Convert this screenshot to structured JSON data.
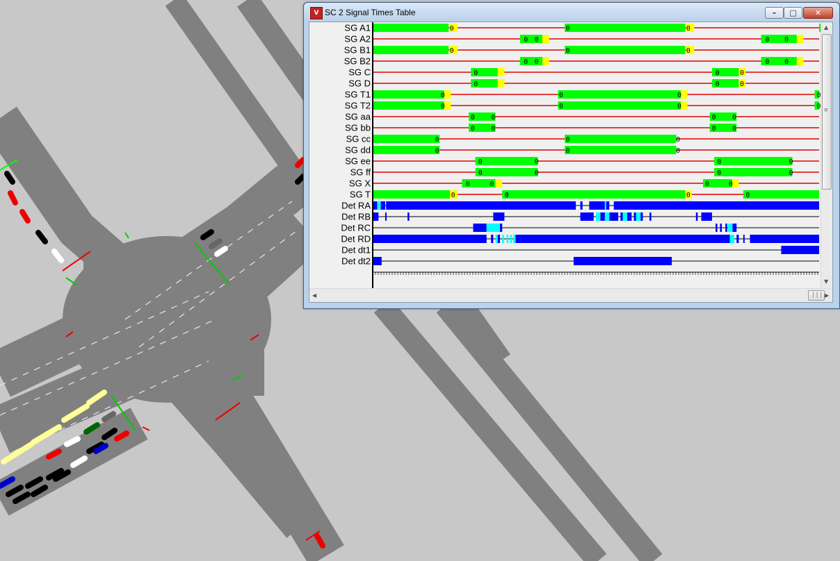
{
  "window": {
    "title": "SC 2 Signal Times Table",
    "app_icon": "vissim-icon",
    "buttons": {
      "minimize": "minimize-icon",
      "maximize": "maximize-icon",
      "close": "close-icon"
    }
  },
  "colors": {
    "green": "#00ff00",
    "amber": "#ffff00",
    "red_line": "#e00000",
    "detector": "#0000ff",
    "detector_occupied": "#00ffff",
    "detector_line": "#000000",
    "background": "#f0f0f0",
    "road": "#808080",
    "ground": "#c8c8c8"
  },
  "signal_table": {
    "time_range": [
      0,
      100
    ],
    "rows": [
      {
        "label": "SG A1",
        "kind": "signal",
        "green": [
          [
            0,
            17
          ],
          [
            43,
            70
          ],
          [
            100,
            100
          ]
        ],
        "green_marks": [
          [
            17,
            17.5
          ],
          [
            70,
            70.5
          ]
        ],
        "amber": [
          [
            17.2,
            19
          ],
          [
            70.2,
            72
          ]
        ],
        "zeros": [
          17,
          43,
          70
        ]
      },
      {
        "label": "SG A2",
        "kind": "signal",
        "green": [
          [
            33,
            38
          ],
          [
            87,
            95
          ]
        ],
        "amber": [
          [
            38,
            39.5
          ],
          [
            95,
            96.5
          ]
        ],
        "zeros": [
          33.6,
          36,
          87.7,
          92
        ]
      },
      {
        "label": "SG B1",
        "kind": "signal",
        "green": [
          [
            0,
            17
          ],
          [
            43,
            70
          ]
        ],
        "amber": [
          [
            17.2,
            19
          ],
          [
            70.2,
            72
          ]
        ],
        "zeros": [
          17,
          43,
          70
        ]
      },
      {
        "label": "SG B2",
        "kind": "signal",
        "green": [
          [
            33,
            38
          ],
          [
            87,
            95
          ]
        ],
        "amber": [
          [
            38,
            39.5
          ],
          [
            95,
            96.5
          ]
        ],
        "zeros": [
          33.6,
          36,
          87.7,
          92
        ]
      },
      {
        "label": "SG C",
        "kind": "signal",
        "green": [
          [
            22,
            28
          ],
          [
            76,
            82
          ]
        ],
        "amber": [
          [
            28,
            29.5
          ],
          [
            82,
            83.5
          ]
        ],
        "zeros": [
          22.4,
          76.5,
          82
        ]
      },
      {
        "label": "SG D",
        "kind": "signal",
        "green": [
          [
            22,
            28
          ],
          [
            76,
            82
          ]
        ],
        "amber": [
          [
            28,
            29.5
          ],
          [
            82,
            83.5
          ]
        ],
        "zeros": [
          22.4,
          76.5,
          82
        ]
      },
      {
        "label": "SG T1",
        "kind": "signal",
        "green": [
          [
            0,
            16
          ],
          [
            41.5,
            69
          ],
          [
            99,
            100
          ]
        ],
        "amber": [
          [
            16,
            17.5
          ],
          [
            69,
            70.5
          ]
        ],
        "zeros": [
          15,
          41.5,
          68,
          99.2
        ]
      },
      {
        "label": "SG T2",
        "kind": "signal",
        "green": [
          [
            0,
            16
          ],
          [
            41.5,
            69
          ],
          [
            99,
            100
          ]
        ],
        "amber": [
          [
            16,
            17.5
          ],
          [
            69,
            70.5
          ]
        ],
        "zeros": [
          15,
          41.5,
          68,
          99.2
        ]
      },
      {
        "label": "SG aa",
        "kind": "signal",
        "green": [
          [
            21.5,
            27.5
          ],
          [
            75.5,
            81.5
          ]
        ],
        "amber": [],
        "zeros": [
          21.7,
          26.3,
          75.7,
          80.3
        ]
      },
      {
        "label": "SG bb",
        "kind": "signal",
        "green": [
          [
            21.5,
            27.5
          ],
          [
            75.5,
            81.5
          ]
        ],
        "amber": [],
        "zeros": [
          21.7,
          26.3,
          75.7,
          80.3
        ]
      },
      {
        "label": "SG cc",
        "kind": "signal",
        "green": [
          [
            0,
            15
          ],
          [
            43,
            68
          ]
        ],
        "amber": [],
        "zeros": [
          13.7,
          43,
          67.7
        ]
      },
      {
        "label": "SG dd",
        "kind": "signal",
        "green": [
          [
            0,
            15
          ],
          [
            43,
            68
          ]
        ],
        "amber": [],
        "zeros": [
          13.7,
          43,
          67.7
        ]
      },
      {
        "label": "SG ee",
        "kind": "signal",
        "green": [
          [
            23,
            37
          ],
          [
            76.5,
            94
          ]
        ],
        "amber": [],
        "zeros": [
          23.4,
          36,
          76.9,
          93
        ]
      },
      {
        "label": "SG ff",
        "kind": "signal",
        "green": [
          [
            23,
            37
          ],
          [
            76.5,
            94
          ]
        ],
        "amber": [],
        "zeros": [
          23.4,
          36,
          76.9,
          93
        ]
      },
      {
        "label": "SG X",
        "kind": "signal",
        "green": [
          [
            20,
            27.5
          ],
          [
            74,
            80.5
          ]
        ],
        "amber": [
          [
            27.5,
            29
          ],
          [
            80.5,
            82
          ]
        ],
        "zeros": [
          20.6,
          26,
          74.2,
          79.5
        ]
      },
      {
        "label": "SG T",
        "kind": "signal",
        "green": [
          [
            0,
            17.3
          ],
          [
            29,
            70
          ],
          [
            83,
            100
          ]
        ],
        "amber": [
          [
            17.3,
            19
          ],
          [
            70,
            71.5
          ]
        ],
        "zeros": [
          17.3,
          29.3,
          70,
          83.3
        ]
      },
      {
        "label": "Det RA",
        "kind": "detector",
        "on": [
          [
            0,
            1
          ],
          [
            1.8,
            2.8
          ],
          [
            3,
            45.5
          ],
          [
            46.5,
            47
          ],
          [
            48.5,
            52
          ],
          [
            52.2,
            53
          ],
          [
            54,
            100
          ]
        ],
        "occ": [
          [
            1,
            1.8
          ],
          [
            52,
            52.2
          ]
        ]
      },
      {
        "label": "Det RB",
        "kind": "detector",
        "on": [
          [
            0,
            1.3
          ],
          [
            2.8,
            3.1
          ],
          [
            7.8,
            8.2
          ],
          [
            27,
            29.5
          ],
          [
            46.5,
            49.5
          ],
          [
            51,
            52
          ],
          [
            53,
            55
          ],
          [
            55.5,
            56
          ],
          [
            57,
            58
          ],
          [
            58.5,
            59
          ],
          [
            60,
            60.5
          ],
          [
            62,
            62.4
          ],
          [
            72.4,
            72.8
          ],
          [
            73.6,
            76
          ]
        ],
        "occ": [
          [
            50,
            51
          ],
          [
            52,
            53
          ],
          [
            56,
            57
          ],
          [
            59,
            60
          ]
        ]
      },
      {
        "label": "Det RC",
        "kind": "detector",
        "on": [
          [
            22.5,
            25.5
          ],
          [
            26,
            26.4
          ],
          [
            28.5,
            29
          ],
          [
            76.8,
            77.2
          ],
          [
            77.8,
            78.2
          ],
          [
            79,
            79.4
          ],
          [
            80.6,
            81.5
          ]
        ],
        "occ": [
          [
            25.5,
            28.5
          ],
          [
            79.6,
            80.6
          ]
        ]
      },
      {
        "label": "Det RD",
        "kind": "detector",
        "on": [
          [
            0,
            25.5
          ],
          [
            26.5,
            27
          ],
          [
            28,
            28.5
          ],
          [
            32,
            80
          ],
          [
            81.5,
            82
          ],
          [
            83,
            83.3
          ],
          [
            84.5,
            100
          ]
        ],
        "occ": [
          [
            27.5,
            28
          ],
          [
            29,
            29.4
          ],
          [
            30,
            30.4
          ],
          [
            30.8,
            31.2
          ],
          [
            31.5,
            32
          ],
          [
            80,
            81
          ]
        ]
      },
      {
        "label": "Det dt1",
        "kind": "detector",
        "on": [
          [
            91.5,
            100
          ]
        ],
        "occ": []
      },
      {
        "label": "Det dt2",
        "kind": "detector",
        "on": [
          [
            0,
            2
          ],
          [
            45,
            67
          ]
        ],
        "occ": []
      }
    ]
  },
  "scrollbars": {
    "vertical": {
      "up_arrow": "arrow-up-icon",
      "down_arrow": "arrow-down-icon",
      "grip": "≡"
    },
    "horizontal": {
      "left_arrow": "arrow-left-icon",
      "right_arrow": "arrow-right-icon",
      "grip": "|||"
    }
  }
}
